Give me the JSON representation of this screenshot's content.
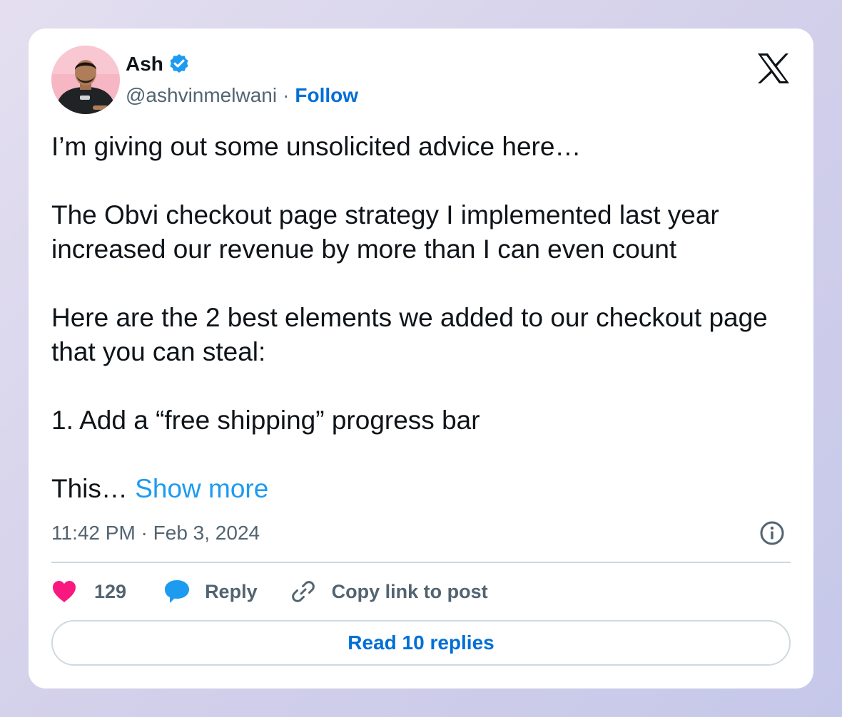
{
  "author": {
    "name": "Ash",
    "handle": "@ashvinmelwani",
    "separator": "·",
    "follow_label": "Follow"
  },
  "tweet": {
    "paragraphs": [
      "I’m giving out some unsolicited advice here…",
      "The Obvi checkout page strategy I implemented last year increased our revenue by more than I can even count",
      "Here are the 2 best elements we added to our checkout page that you can steal:",
      "1. Add a “free shipping” progress bar"
    ],
    "truncated_text": "This… ",
    "show_more_label": "Show more"
  },
  "timestamp": "11:42 PM · Feb 3, 2024",
  "actions": {
    "like_count": "129",
    "reply_label": "Reply",
    "copy_link_label": "Copy link to post"
  },
  "read_replies_label": "Read 10 replies",
  "icons": {
    "logo": "x-logo-icon",
    "verified": "verified-badge-icon",
    "info": "info-icon",
    "like": "heart-icon",
    "reply": "speech-bubble-icon",
    "copy_link": "link-icon"
  },
  "colors": {
    "link_blue": "#006fd6",
    "show_more_blue": "#1d9bf0",
    "verified_blue": "#1d9bf0",
    "heart_pink": "#f91880",
    "reply_blue": "#1d9bf0",
    "secondary_text": "#536471",
    "divider": "#cfd9de"
  }
}
